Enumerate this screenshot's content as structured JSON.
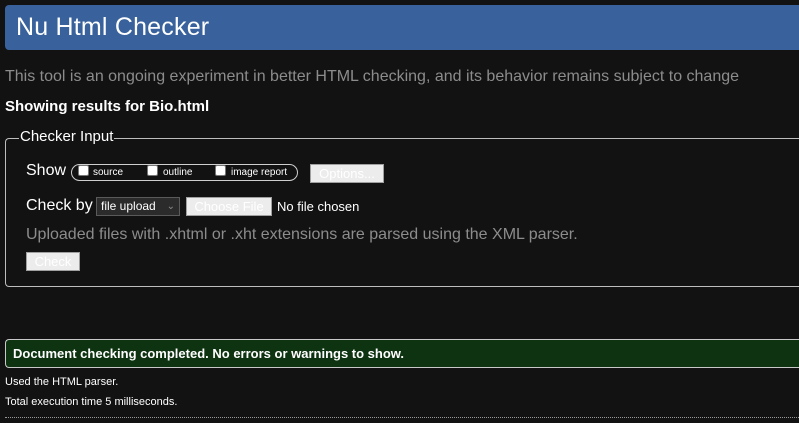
{
  "header": {
    "title": "Nu Html Checker"
  },
  "intro": {
    "subtitle": "This tool is an ongoing experiment in better HTML checking, and its behavior remains subject to change",
    "results_for": "Showing results for Bio.html"
  },
  "checker_input": {
    "legend": "Checker Input",
    "show_label": "Show",
    "show_options": [
      {
        "label": "source",
        "checked": false
      },
      {
        "label": "outline",
        "checked": false
      },
      {
        "label": "image report",
        "checked": false
      }
    ],
    "options_button": "Options...",
    "check_by_label": "Check by",
    "check_by_selected": "file upload",
    "choose_file_button": "Choose File",
    "file_status": "No file chosen",
    "note": "Uploaded files with .xhtml or .xht extensions are parsed using the XML parser.",
    "check_button": "Check"
  },
  "result": {
    "message": "Document checking completed. No errors or warnings to show.",
    "parser_info": "Used the HTML parser.",
    "timing_info": "Total execution time 5 milliseconds."
  },
  "colors": {
    "background": "#121212",
    "header_bg": "#39629c",
    "success_bg": "#0d3310",
    "muted_text": "#8c8c8c"
  }
}
